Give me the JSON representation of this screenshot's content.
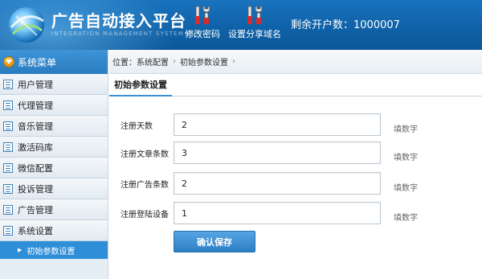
{
  "header": {
    "title": "广告自动接入平台",
    "subtitle": "INTEGRATION MANAGEMENT SYSTEM BUT",
    "tools": [
      {
        "label": "修改密码",
        "icon": "tools-icon"
      },
      {
        "label": "设置分享域名",
        "icon": "tools-icon"
      }
    ],
    "remaining": "剩余开户数：1000007"
  },
  "sidebar": {
    "title": "系统菜单",
    "items": [
      {
        "label": "用户管理"
      },
      {
        "label": "代理管理"
      },
      {
        "label": "音乐管理"
      },
      {
        "label": "激活码库"
      },
      {
        "label": "微信配置"
      },
      {
        "label": "投诉管理"
      },
      {
        "label": "广告管理"
      },
      {
        "label": "系统设置"
      }
    ],
    "active_sub": "初始参数设置"
  },
  "breadcrumb": {
    "prefix": "位置：",
    "items": [
      "系统配置",
      "初始参数设置"
    ]
  },
  "tab": {
    "label": "初始参数设置"
  },
  "form": {
    "fields": [
      {
        "label": "注册天数",
        "value": "2",
        "hint": "填数字"
      },
      {
        "label": "注册文章条数",
        "value": "3",
        "hint": "填数字"
      },
      {
        "label": "注册广告条数",
        "value": "2",
        "hint": "填数字"
      },
      {
        "label": "注册登陆设备",
        "value": "1",
        "hint": "填数字"
      }
    ],
    "save_label": "确认保存"
  },
  "colors": {
    "header_bg": "#0f62a8",
    "accent": "#2e8fd8",
    "sidebar_bg": "#e6eef5"
  }
}
